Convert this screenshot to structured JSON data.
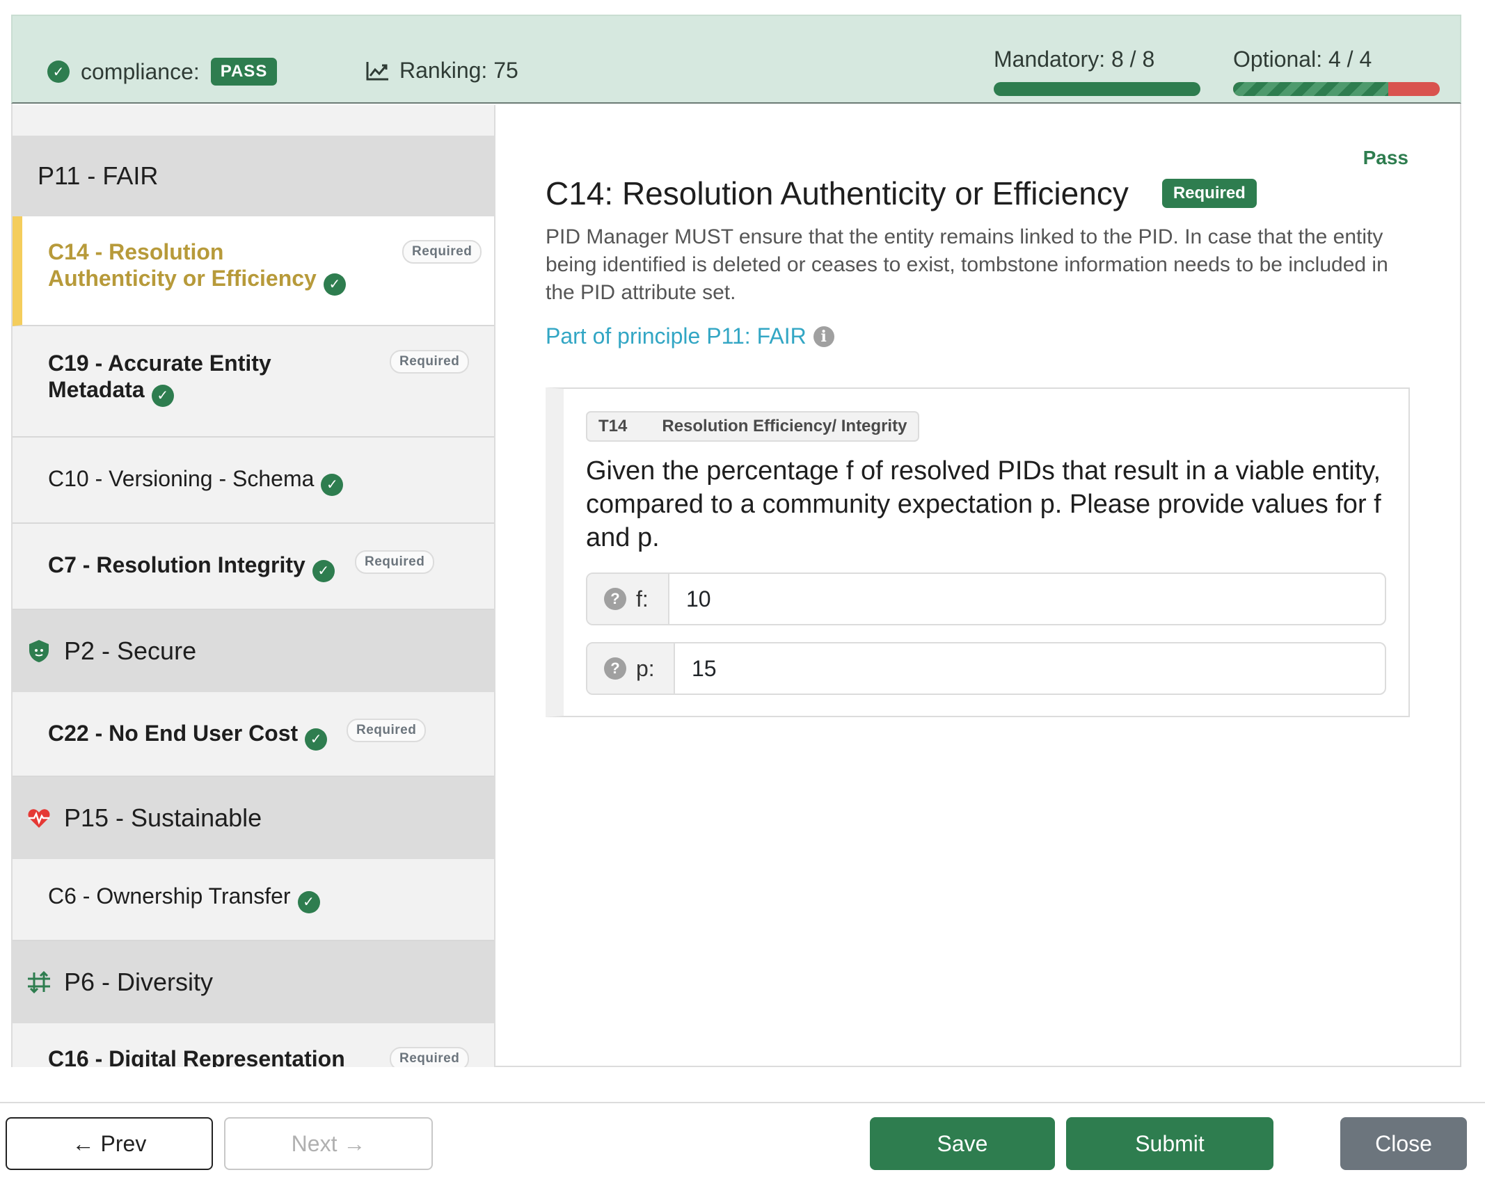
{
  "header": {
    "compliance_label": "compliance:",
    "compliance_status": "PASS",
    "ranking_label": "Ranking: 75",
    "mandatory_label": "Mandatory: 8 / 8",
    "mandatory_progress": 1.0,
    "optional_label": "Optional: 4 / 4",
    "optional_progress": 0.75
  },
  "sidebar": {
    "items": [
      {
        "type": "principle",
        "label": "P11 - FAIR",
        "icon": ""
      },
      {
        "type": "criterion",
        "label": "C14 - Resolution Authenticity or Efficiency",
        "required": "Required",
        "passed": true,
        "active": true
      },
      {
        "type": "criterion",
        "label": "C19 - Accurate Entity Metadata",
        "required": "Required",
        "passed": true
      },
      {
        "type": "criterion",
        "label": "C10 - Versioning - Schema",
        "passed": true
      },
      {
        "type": "criterion",
        "label": "C7 - Resolution Integrity",
        "required": "Required",
        "passed": true
      },
      {
        "type": "principle",
        "label": "P2 - Secure",
        "icon": "shield-icon"
      },
      {
        "type": "criterion",
        "label": "C22 - No End User Cost",
        "required": "Required",
        "passed": true
      },
      {
        "type": "principle",
        "label": "P15 - Sustainable",
        "icon": "heartbeat-icon"
      },
      {
        "type": "criterion",
        "label": "C6 - Ownership Transfer",
        "passed": true
      },
      {
        "type": "principle",
        "label": "P6 - Diversity",
        "icon": "arrows-icon"
      },
      {
        "type": "criterion",
        "label": "C16 - Digital Representation",
        "required": "Required"
      }
    ]
  },
  "main": {
    "status": "Pass",
    "title": "C14: Resolution Authenticity or Efficiency",
    "required_badge": "Required",
    "description": "PID Manager MUST ensure that the entity remains linked to the PID. In case that the entity being identified is deleted or ceases to exist, tombstone information needs to be included in the PID attribute set.",
    "principle_link": "Part of principle P11: FAIR",
    "test": {
      "id": "T14",
      "name": "Resolution Efficiency/ Integrity",
      "question": "Given the percentage f of resolved PIDs that result in a viable entity, compared to a community expectation p. Please provide values for f and p.",
      "fields": [
        {
          "label": "f:",
          "value": "10"
        },
        {
          "label": "p:",
          "value": "15"
        }
      ]
    }
  },
  "footer": {
    "prev": "← Prev",
    "next": "Next →",
    "save": "Save",
    "submit": "Submit",
    "close": "Close"
  },
  "colors": {
    "accent": "#2e7d4f",
    "header_bg": "#d6e8df",
    "active_marker": "#f4cd5c",
    "active_text": "#b79a3a",
    "link": "#32a6c4",
    "danger": "#d9534f"
  }
}
